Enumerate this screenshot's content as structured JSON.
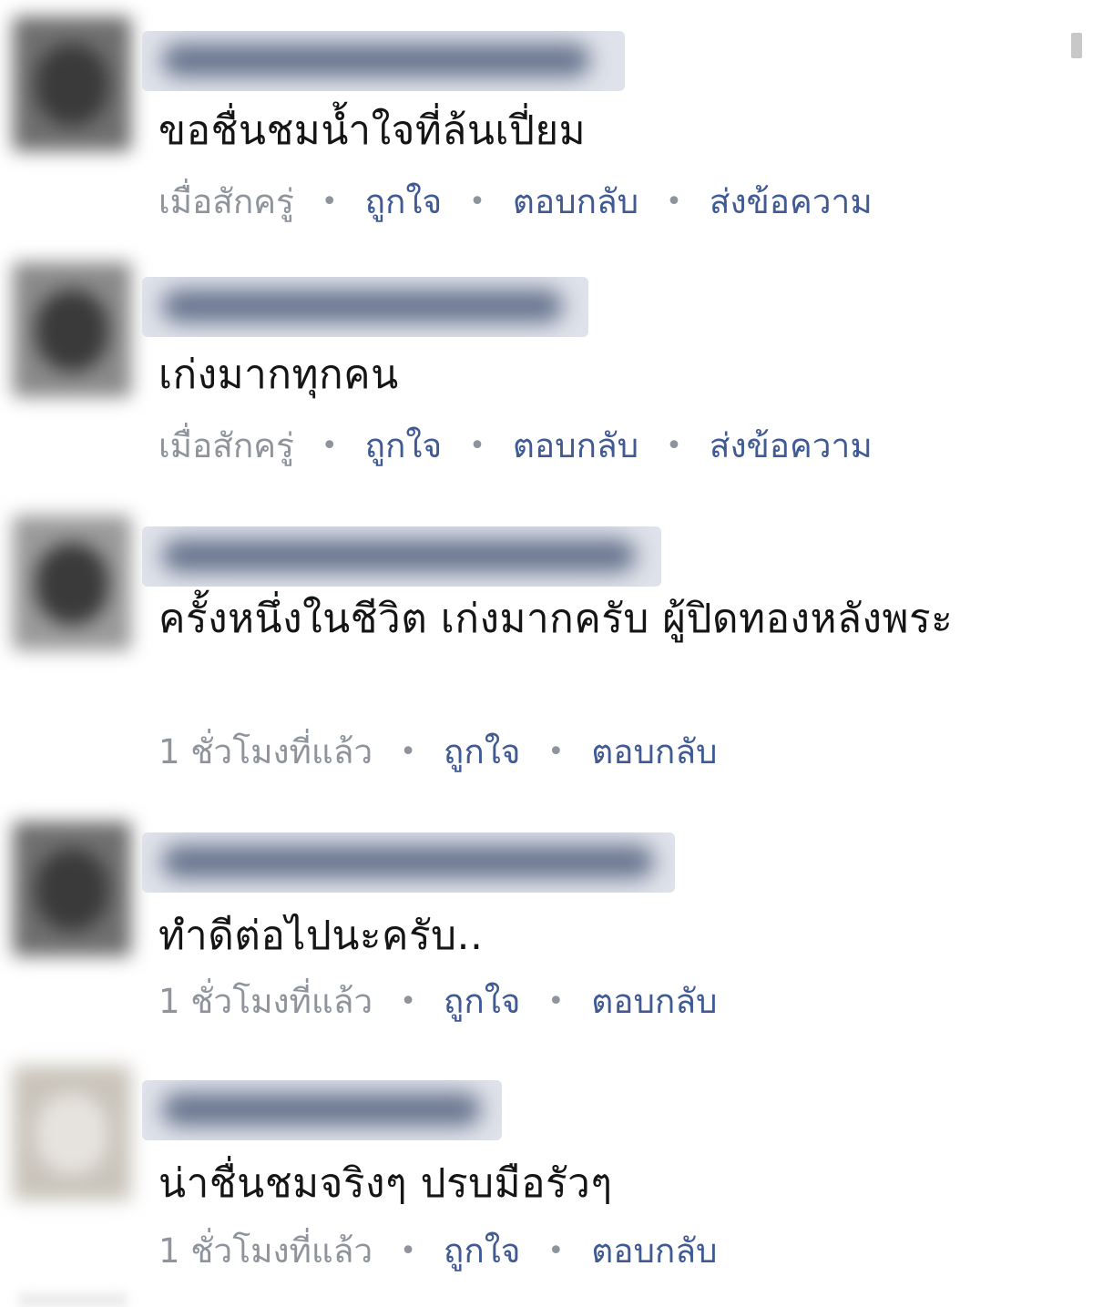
{
  "comments": [
    {
      "text": "ขอชื่นชมน้ำใจที่ล้นเปี่ยม",
      "time": "เมื่อสักครู่",
      "actions": [
        "ถูกใจ",
        "ตอบกลับ",
        "ส่งข้อความ"
      ]
    },
    {
      "text": "เก่งมากทุกคน",
      "time": "เมื่อสักครู่",
      "actions": [
        "ถูกใจ",
        "ตอบกลับ",
        "ส่งข้อความ"
      ]
    },
    {
      "text": "ครั้งหนึ่งในชีวิต เก่งมากครับ ผู้ปิดทองหลังพระ",
      "time": "1 ชั่วโมงที่แล้ว",
      "actions": [
        "ถูกใจ",
        "ตอบกลับ"
      ]
    },
    {
      "text": "ทำดีต่อไปนะครับ..",
      "time": "1 ชั่วโมงที่แล้ว",
      "actions": [
        "ถูกใจ",
        "ตอบกลับ"
      ]
    },
    {
      "text": "น่าชื่นชมจริงๆ ปรบมือรัวๆ",
      "time": "1 ชั่วโมงที่แล้ว",
      "actions": [
        "ถูกใจ",
        "ตอบกลับ"
      ]
    }
  ],
  "separator": "•"
}
